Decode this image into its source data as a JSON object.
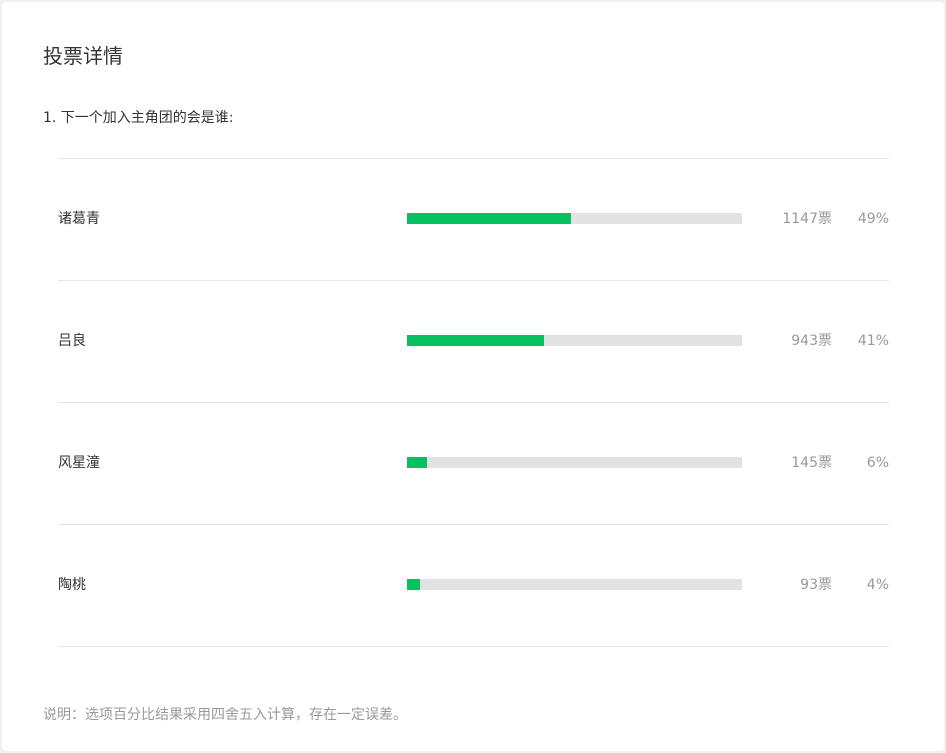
{
  "page": {
    "title": "投票详情"
  },
  "question": {
    "text": "1. 下一个加入主角团的会是谁:"
  },
  "options": [
    {
      "name": "诸葛青",
      "votes": "1147票",
      "percent": "49%",
      "fraction": 0.49
    },
    {
      "name": "吕良",
      "votes": "943票",
      "percent": "41%",
      "fraction": 0.41
    },
    {
      "name": "风星潼",
      "votes": "145票",
      "percent": "6%",
      "fraction": 0.06
    },
    {
      "name": "陶桃",
      "votes": "93票",
      "percent": "4%",
      "fraction": 0.04
    }
  ],
  "note": {
    "text": "说明：选项百分比结果采用四舍五入计算，存在一定误差。"
  },
  "colors": {
    "bar_fill": "#07c160",
    "bar_track": "#e2e2e2"
  }
}
